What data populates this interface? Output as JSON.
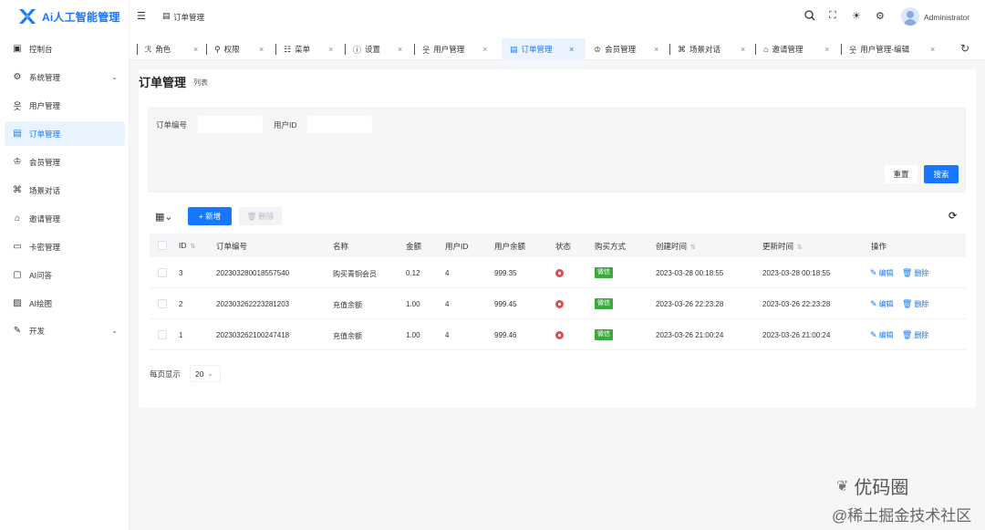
{
  "app": {
    "title": "Ai人工智能管理"
  },
  "sidebar": {
    "items": [
      {
        "label": "控制台",
        "icon": "dashboard-icon"
      },
      {
        "label": "系统管理",
        "icon": "gear-icon",
        "chevron": "⌄"
      },
      {
        "label": "用户管理",
        "icon": "user-icon"
      },
      {
        "label": "订单管理",
        "icon": "order-icon",
        "active": true
      },
      {
        "label": "会员管理",
        "icon": "crown-icon"
      },
      {
        "label": "场景对话",
        "icon": "scene-icon"
      },
      {
        "label": "邀请管理",
        "icon": "invite-icon"
      },
      {
        "label": "卡密管理",
        "icon": "card-icon"
      },
      {
        "label": "AI问答",
        "icon": "chat-icon"
      },
      {
        "label": "AI绘图",
        "icon": "image-icon"
      },
      {
        "label": "开发",
        "icon": "dev-icon",
        "chevron": "⌄"
      }
    ]
  },
  "header": {
    "breadcrumb": "订单管理",
    "user": "Administrator"
  },
  "tabs": [
    {
      "label": "角色",
      "icon": "role-icon"
    },
    {
      "label": "权限",
      "icon": "key-icon"
    },
    {
      "label": "菜单",
      "icon": "menu-icon"
    },
    {
      "label": "设置",
      "icon": "info-icon"
    },
    {
      "label": "用户管理",
      "icon": "user-icon"
    },
    {
      "label": "订单管理",
      "icon": "order-icon",
      "active": true
    },
    {
      "label": "会员管理",
      "icon": "crown-icon"
    },
    {
      "label": "场景对话",
      "icon": "scene-icon"
    },
    {
      "label": "邀请管理",
      "icon": "invite-icon"
    },
    {
      "label": "用户管理-编辑",
      "icon": "user-icon"
    }
  ],
  "page": {
    "title": "订单管理",
    "subtitle": "列表"
  },
  "search": {
    "order_no_label": "订单编号",
    "order_no_value": "",
    "user_id_label": "用户ID",
    "user_id_value": "",
    "reset_label": "重置",
    "search_label": "搜索"
  },
  "toolbar": {
    "add_label": "+ 新增",
    "delete_label": "删除"
  },
  "table": {
    "columns": [
      "ID",
      "订单编号",
      "名称",
      "金额",
      "用户ID",
      "用户余额",
      "状态",
      "购买方式",
      "创建时间",
      "更新时间",
      "操作"
    ],
    "rows": [
      {
        "id": "3",
        "order_no": "20230328001855754​0",
        "name": "购买青铜会员",
        "amount": "0.12",
        "user_id": "4",
        "balance": "999.35",
        "pay": "微信",
        "created": "2023-03-28 00:18:55",
        "updated": "2023-03-28 00:18:55"
      },
      {
        "id": "2",
        "order_no": "202303262223281203",
        "name": "充值余额",
        "amount": "1.00",
        "user_id": "4",
        "balance": "999.45",
        "pay": "微信",
        "created": "2023-03-26 22:23:28",
        "updated": "2023-03-26 22:23:28"
      },
      {
        "id": "1",
        "order_no": "202303262100247418",
        "name": "充值余额",
        "amount": "1.00",
        "user_id": "4",
        "balance": "999.46",
        "pay": "微信",
        "created": "2023-03-26 21:00:24",
        "updated": "2023-03-26 21:00:24"
      }
    ],
    "edit_label": "编辑",
    "delete_label": "删除"
  },
  "pagination": {
    "label": "每页显示",
    "size": "20"
  },
  "watermark": {
    "line1": "优码圈",
    "line2": "@稀土掘金技术社区"
  },
  "colors": {
    "primary": "#1677ff",
    "status_red": "#e5484d",
    "wechat_green": "#3ca93c"
  }
}
